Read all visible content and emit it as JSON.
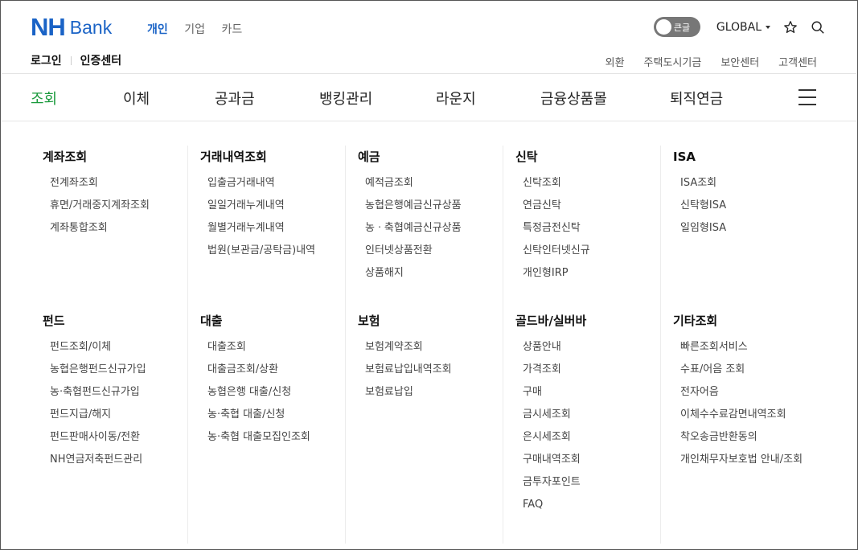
{
  "logo": {
    "nh": "NH",
    "bank": "Bank"
  },
  "segments": [
    {
      "label": "개인",
      "active": true
    },
    {
      "label": "기업",
      "active": false
    },
    {
      "label": "카드",
      "active": false
    }
  ],
  "toggle": {
    "label": "큰글"
  },
  "global": {
    "label": "GLOBAL"
  },
  "icons": {
    "favorite": "star-icon",
    "search": "search-icon",
    "menu": "hamburger-icon"
  },
  "auth": {
    "login": "로그인",
    "cert": "인증센터"
  },
  "util_links": [
    "외환",
    "주택도시기금",
    "보안센터",
    "고객센터"
  ],
  "nav": [
    {
      "label": "조회",
      "active": true
    },
    {
      "label": "이체",
      "active": false
    },
    {
      "label": "공과금",
      "active": false
    },
    {
      "label": "뱅킹관리",
      "active": false
    },
    {
      "label": "라운지",
      "active": false
    },
    {
      "label": "금융상품몰",
      "active": false
    },
    {
      "label": "퇴직연금",
      "active": false
    }
  ],
  "colors": {
    "brand_blue": "#1a63c6",
    "active_green": "#1a9a3c"
  },
  "menu": {
    "col1_top": {
      "title": "계좌조회",
      "items": [
        "전계좌조회",
        "휴면/거래중지계좌조회",
        "계좌통합조회"
      ]
    },
    "col2_top": {
      "title": "거래내역조회",
      "items": [
        "입출금거래내역",
        "일일거래누계내역",
        "월별거래누계내역",
        "법원(보관금/공탁금)내역"
      ]
    },
    "col3_top": {
      "title": "예금",
      "items": [
        "예적금조회",
        "농협은행예금신규상품",
        "농ㆍ축협예금신규상품",
        "인터넷상품전환",
        "상품해지"
      ]
    },
    "col4_top": {
      "title": "신탁",
      "items": [
        "신탁조회",
        "연금신탁",
        "특정금전신탁",
        "신탁인터넷신규",
        "개인형IRP"
      ]
    },
    "col5_top": {
      "title": "ISA",
      "items": [
        "ISA조회",
        "신탁형ISA",
        "일임형ISA"
      ]
    },
    "col1_bot": {
      "title": "펀드",
      "items": [
        "펀드조회/이체",
        "농협은행펀드신규가입",
        "농·축협펀드신규가입",
        "펀드지급/해지",
        "펀드판매사이동/전환",
        "NH연금저축펀드관리"
      ]
    },
    "col2_bot": {
      "title": "대출",
      "items": [
        "대출조회",
        "대출금조회/상환",
        "농협은행 대출/신청",
        "농·축협 대출/신청",
        "농·축협 대출모집인조회"
      ]
    },
    "col3_bot": {
      "title": "보험",
      "items": [
        "보험계약조회",
        "보험료납입내역조회",
        "보험료납입"
      ]
    },
    "col4_bot": {
      "title": "골드바/실버바",
      "items": [
        "상품안내",
        "가격조회",
        "구매",
        "금시세조회",
        "은시세조회",
        "구매내역조회",
        "금투자포인트",
        "FAQ"
      ]
    },
    "col5_bot": {
      "title": "기타조회",
      "items": [
        "빠른조회서비스",
        "수표/어음 조회",
        "전자어음",
        "이체수수료감면내역조회",
        "착오송금반환동의",
        "개인채무자보호법 안내/조회"
      ]
    }
  }
}
